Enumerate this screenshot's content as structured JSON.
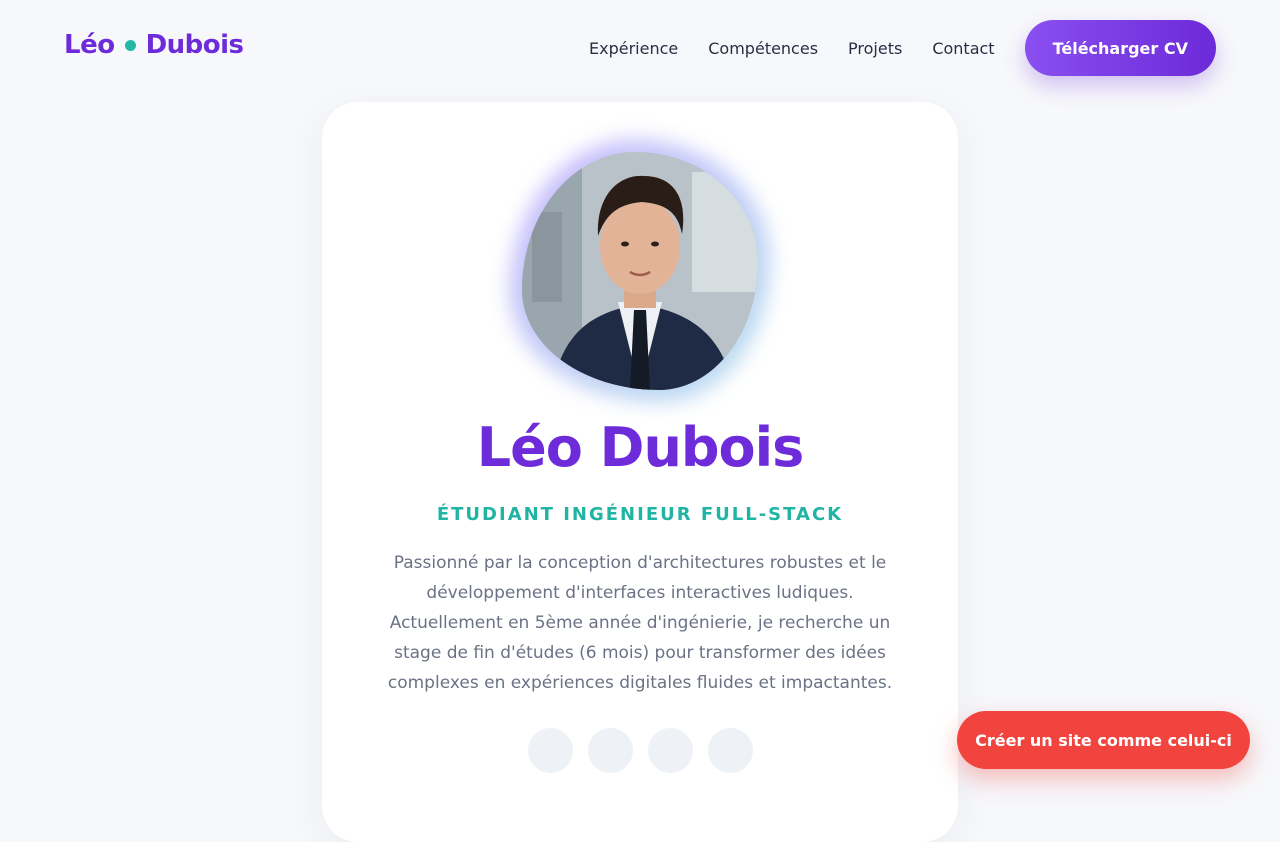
{
  "header": {
    "logo_first": "Léo",
    "logo_last": "Dubois",
    "nav": [
      {
        "label": "Expérience"
      },
      {
        "label": "Compétences"
      },
      {
        "label": "Projets"
      },
      {
        "label": "Contact"
      }
    ],
    "cta_label": "Télécharger CV"
  },
  "profile": {
    "name": "Léo Dubois",
    "role": "ÉTUDIANT INGÉNIEUR FULL-STACK",
    "bio": "Passionné par la conception d'architectures robustes et le développement d'interfaces interactives ludiques. Actuellement en 5ème année d'ingénierie, je recherche un stage de fin d'études (6 mois) pour transformer des idées complexes en expériences digitales fluides et impactantes.",
    "avatar_icon": "profile-photo",
    "social_icons": [
      "social-link-icon",
      "social-link-icon",
      "social-link-icon",
      "social-link-icon"
    ]
  },
  "floating_button": {
    "label": "Créer un site comme celui-ci"
  },
  "colors": {
    "accent_purple": "#6d2bd9",
    "accent_teal": "#1fb4a4",
    "cta_red": "#f2443f",
    "background": "#f7f8fb"
  }
}
